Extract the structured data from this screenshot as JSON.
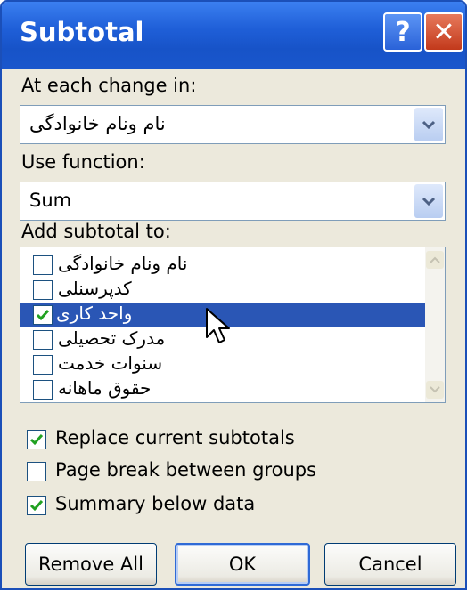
{
  "window": {
    "title": "Subtotal",
    "help_glyph": "?",
    "close_glyph": "✕"
  },
  "group_by": {
    "label": "At each change in:",
    "value": "نام ونام خانوادگی"
  },
  "function": {
    "label": "Use function:",
    "value": "Sum"
  },
  "subtotal_to": {
    "label": "Add subtotal to:",
    "items": [
      {
        "label": "نام ونام خانوادگی",
        "checked": false,
        "selected": false
      },
      {
        "label": "کدپرسنلی",
        "checked": false,
        "selected": false
      },
      {
        "label": "واحد کاری",
        "checked": true,
        "selected": true
      },
      {
        "label": "مدرک تحصیلی",
        "checked": false,
        "selected": false
      },
      {
        "label": "سنوات خدمت",
        "checked": false,
        "selected": false
      },
      {
        "label": "حقوق ماهانه",
        "checked": false,
        "selected": false
      }
    ]
  },
  "options": {
    "replace_current": {
      "label": "Replace current subtotals",
      "checked": true
    },
    "page_break": {
      "label": "Page break between groups",
      "checked": false
    },
    "summary_below": {
      "label": "Summary below data",
      "checked": true
    }
  },
  "buttons": {
    "remove_all": "Remove All",
    "ok": "OK",
    "cancel": "Cancel"
  },
  "colors": {
    "titlebar": "#1f5fd8",
    "selection": "#2a56b5",
    "check": "#21a121"
  }
}
